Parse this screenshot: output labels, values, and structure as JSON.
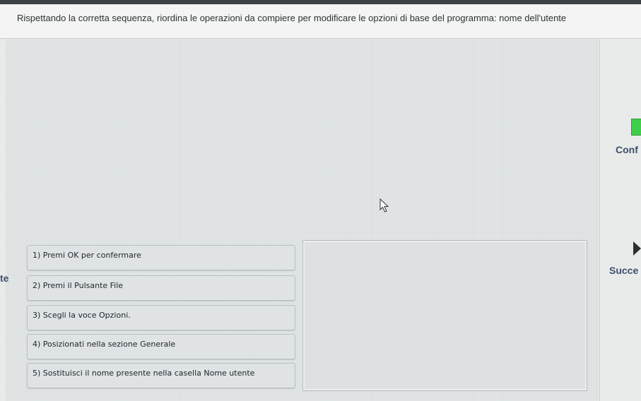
{
  "question": "Rispettando la corretta sequenza, riordina le operazioni da compiere per modificare le opzioni di base del programma: nome dell'utente",
  "left_fragment": "te",
  "right_panel": {
    "confirm_label": "Conf",
    "next_label": "Succe"
  },
  "steps": [
    {
      "label": "1) Premi OK per confermare"
    },
    {
      "label": "2) Premi il Pulsante File"
    },
    {
      "label": "3) Scegli la voce Opzioni."
    },
    {
      "label": "4) Posizionati nella sezione Generale"
    },
    {
      "label": "5) Sostituisci il nome presente nella casella Nome utente"
    }
  ],
  "icons": {
    "confirm": "green-square-icon",
    "next": "play-arrow-icon",
    "cursor": "mouse-pointer-icon"
  },
  "colors": {
    "confirm_button": "#3fcf4a",
    "label_text": "#3d4f6e"
  }
}
